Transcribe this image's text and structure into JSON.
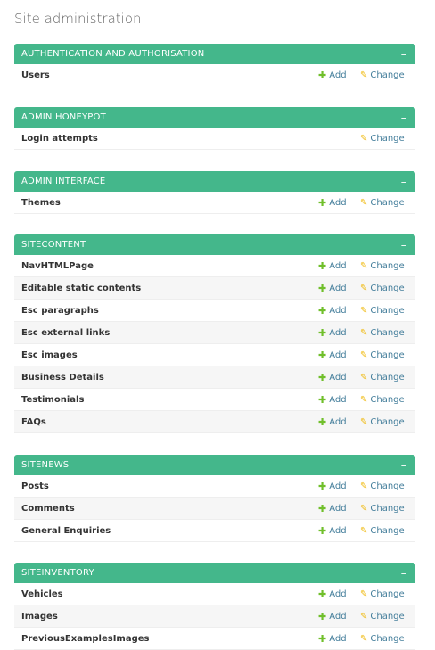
{
  "page_title": "Site administration",
  "collapse_symbol": "–",
  "add_label": "Add",
  "change_label": "Change",
  "colors": {
    "header": "#44b78b",
    "add_icon": "#70bf2b",
    "change_icon": "#efb80b"
  },
  "icons": {
    "add": "plus-icon",
    "change": "pencil-icon"
  },
  "modules": [
    {
      "title": "Authentication and Authorisation",
      "models": [
        {
          "name": "Users",
          "add": true
        }
      ]
    },
    {
      "title": "Admin Honeypot",
      "models": [
        {
          "name": "Login attempts",
          "add": false
        }
      ]
    },
    {
      "title": "Admin Interface",
      "models": [
        {
          "name": "Themes",
          "add": true
        }
      ]
    },
    {
      "title": "Sitecontent",
      "models": [
        {
          "name": "NavHTMLPage",
          "add": true
        },
        {
          "name": "Editable static contents",
          "add": true
        },
        {
          "name": "Esc paragraphs",
          "add": true
        },
        {
          "name": "Esc external links",
          "add": true
        },
        {
          "name": "Esc images",
          "add": true
        },
        {
          "name": "Business Details",
          "add": true
        },
        {
          "name": "Testimonials",
          "add": true
        },
        {
          "name": "FAQs",
          "add": true
        }
      ]
    },
    {
      "title": "Sitenews",
      "models": [
        {
          "name": "Posts",
          "add": true
        },
        {
          "name": "Comments",
          "add": true
        },
        {
          "name": "General Enquiries",
          "add": true
        }
      ]
    },
    {
      "title": "Siteinventory",
      "models": [
        {
          "name": "Vehicles",
          "add": true
        },
        {
          "name": "Images",
          "add": true
        },
        {
          "name": "PreviousExamplesImages",
          "add": true
        }
      ]
    }
  ]
}
